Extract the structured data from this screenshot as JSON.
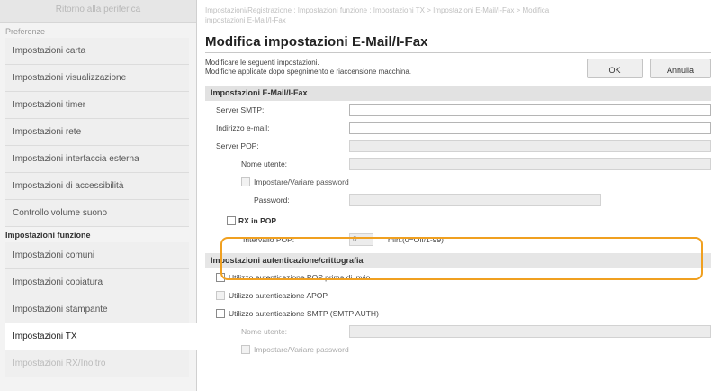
{
  "sidebar": {
    "top_link": "Ritorno alla periferica",
    "section_preferences": "Preferenze",
    "items_pref": [
      "Impostazioni carta",
      "Impostazioni visualizzazione",
      "Impostazioni timer",
      "Impostazioni rete",
      "Impostazioni interfaccia esterna",
      "Impostazioni di accessibilità",
      "Controllo volume suono"
    ],
    "section_functions": "Impostazioni funzione",
    "items_func": [
      "Impostazioni comuni",
      "Impostazioni copiatura",
      "Impostazioni stampante",
      "Impostazioni TX",
      "Impostazioni RX/Inoltro"
    ],
    "active_item": "Impostazioni TX"
  },
  "breadcrumb": {
    "line1": "Impostazioni/Registrazione : Impostazioni funzione : Impostazioni TX > Impostazioni E-Mail/I-Fax > Modifica",
    "line2": "impostazioni E-Mail/I-Fax"
  },
  "page_title": "Modifica impostazioni E-Mail/I-Fax",
  "info": {
    "line1": "Modificare le seguenti impostazioni.",
    "line2": "Modifiche applicate dopo spegnimento e riaccensione macchina."
  },
  "buttons": {
    "ok": "OK",
    "cancel": "Annulla"
  },
  "section_email": {
    "title": "Impostazioni E-Mail/I-Fax",
    "smtp_server_label": "Server SMTP:",
    "email_address_label": "Indirizzo e-mail:",
    "pop_server_label": "Server POP:",
    "username_label": "Nome utente:",
    "set_password_label": "Impostare/Variare password",
    "password_label": "Password:",
    "rx_in_pop_label": "RX in POP",
    "pop_interval_label": "Intervallo POP:",
    "pop_interval_value": "0",
    "pop_interval_hint": "min.(0=Off/1-99)"
  },
  "section_auth": {
    "title": "Impostazioni autenticazione/crittografia",
    "pop_before_send_label": "Utilizzo autenticazione POP prima di invio",
    "apop_label": "Utilizzo autenticazione APOP",
    "smtp_auth_label": "Utilizzo autenticazione SMTP (SMTP AUTH)",
    "username_label": "Nome utente:",
    "set_password_label": "Impostare/Variare password"
  },
  "colors": {
    "highlight": "#f0a020",
    "section_bg": "#e2e2e2",
    "sidebar_bg": "#f3f3f3"
  }
}
